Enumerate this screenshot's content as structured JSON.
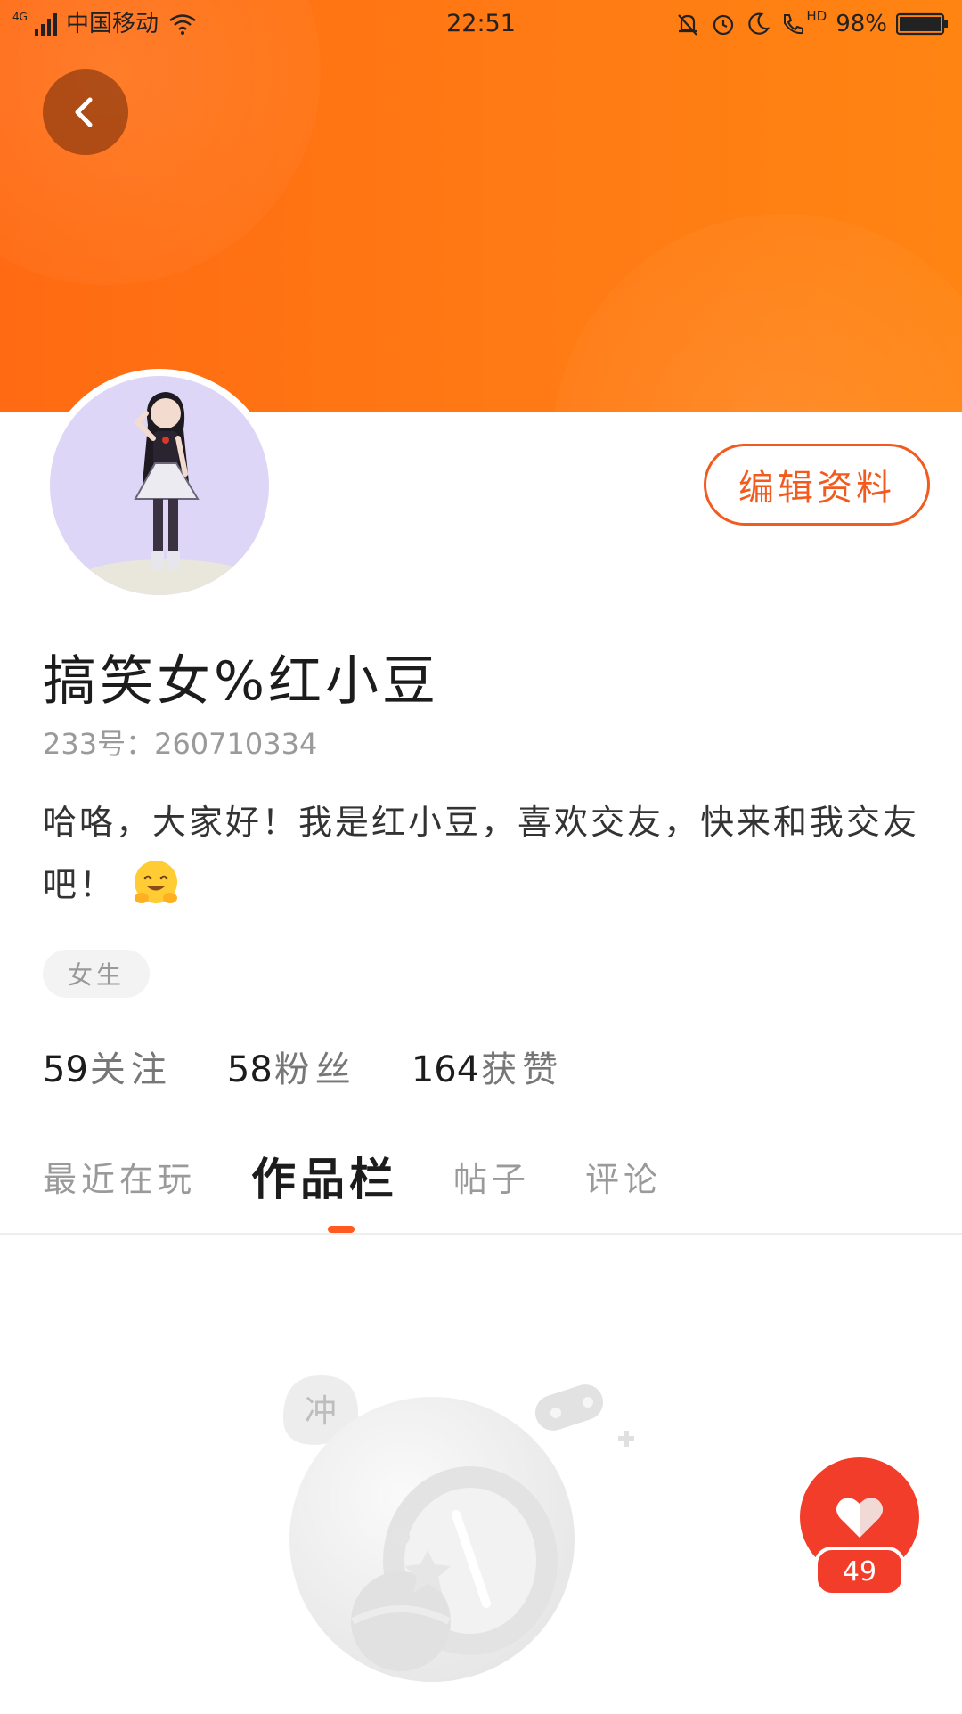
{
  "status_bar": {
    "network_type": "4G",
    "carrier": "中国移动",
    "time": "22:51",
    "hd_label": "HD",
    "battery": "98%",
    "icons": [
      "signal-icon",
      "wifi-icon",
      "bell-off-icon",
      "alarm-icon",
      "moon-icon",
      "hd-call-icon",
      "battery-icon"
    ]
  },
  "header": {
    "colors": {
      "start": "#ff6a12",
      "end": "#ff8412"
    },
    "back_icon": "chevron-left-icon"
  },
  "profile": {
    "avatar_icon": "avatar",
    "edit_label": "编辑资料",
    "username": "搞笑女%红小豆",
    "user_id": "233号：260710334",
    "bio_text": "哈咯，大家好！我是红小豆，喜欢交友，快来和我交友吧！",
    "bio_emoji": "hugging-face-emoji",
    "gender": "女生",
    "accent_color": "#f25a1e"
  },
  "stats": [
    {
      "num": "59",
      "label": "关注"
    },
    {
      "num": "58",
      "label": "粉丝"
    },
    {
      "num": "164",
      "label": "获赞"
    }
  ],
  "tabs": [
    {
      "label": "最近在玩",
      "active": false
    },
    {
      "label": "作品栏",
      "active": true
    },
    {
      "label": "帖子",
      "active": false
    },
    {
      "label": "评论",
      "active": false
    }
  ],
  "empty_state": {
    "bubble_text": "冲"
  },
  "like_fab": {
    "icon": "heart-icon",
    "count": "49",
    "color": "#f23d2b"
  }
}
